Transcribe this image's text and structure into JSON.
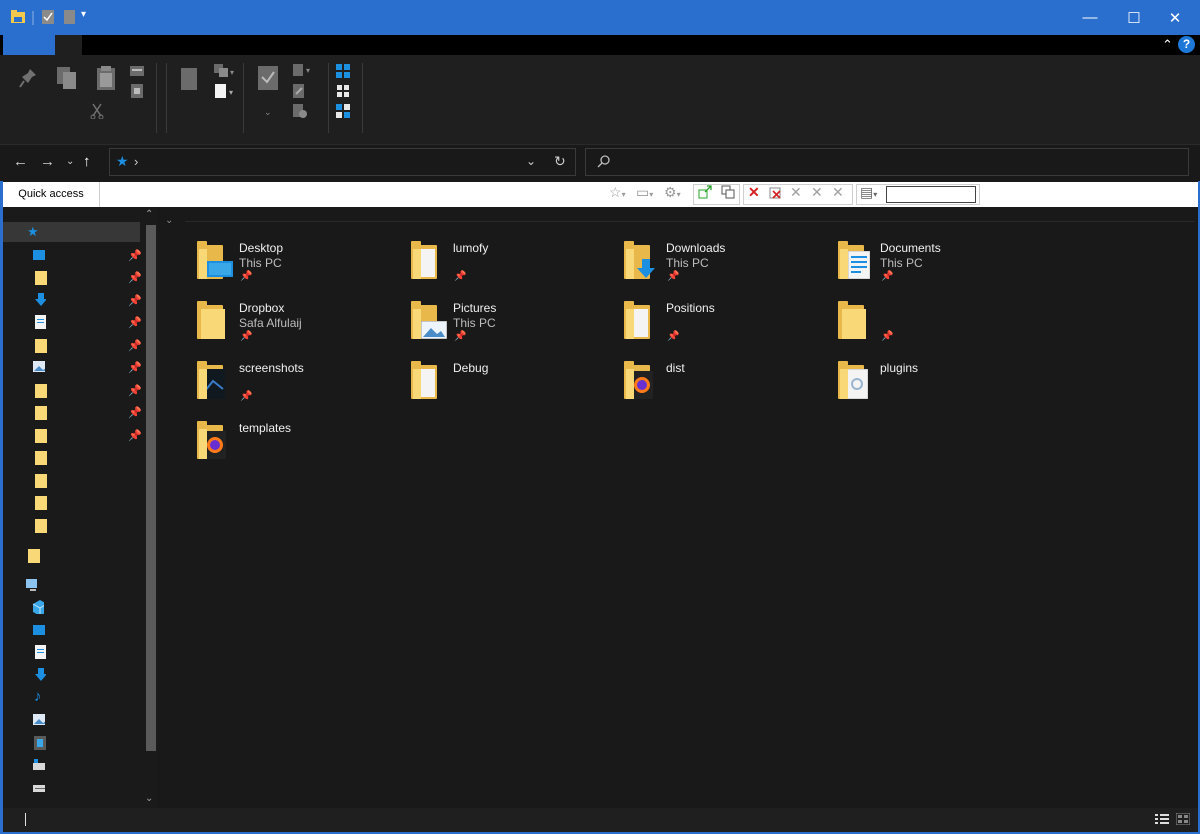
{
  "window": {
    "minimize_glyph": "—",
    "maximize_glyph": "☐",
    "close_glyph": "✕"
  },
  "ribbon": {
    "collapse_glyph": "⌃",
    "help_glyph": "?"
  },
  "address_bar": {
    "location_icon": "star-icon",
    "separator": "›",
    "value": ""
  },
  "search": {
    "placeholder": "",
    "icon": "search-icon"
  },
  "toolbar": {
    "breadcrumb_label": "Quick access",
    "filter_value": ""
  },
  "group_header": {
    "chevron": "⌄"
  },
  "colors": {
    "accent": "#2b6fce",
    "folder_back": "#e8b94a",
    "folder_front": "#f9d877",
    "background": "#191919"
  },
  "files": [
    {
      "name": "Desktop",
      "location": "This PC",
      "pinned": true,
      "overlay": "desktop-icon"
    },
    {
      "name": "lumofy",
      "location": "",
      "pinned": true,
      "overlay": "document-icon"
    },
    {
      "name": "Downloads",
      "location": "This PC",
      "pinned": true,
      "overlay": "download-arrow-icon"
    },
    {
      "name": "Documents",
      "location": "This PC",
      "pinned": true,
      "overlay": "text-document-icon"
    },
    {
      "name": "Dropbox",
      "location": "Safa Alfulaij",
      "pinned": true,
      "overlay": "none"
    },
    {
      "name": "Pictures",
      "location": "This PC",
      "pinned": true,
      "overlay": "landscape-photo-icon"
    },
    {
      "name": "Positions",
      "location": "",
      "pinned": true,
      "overlay": "document-icon"
    },
    {
      "name": "",
      "location": "",
      "pinned": true,
      "overlay": "none"
    },
    {
      "name": "screenshots",
      "location": "",
      "pinned": true,
      "overlay": "screenshot-thumbnail-icon"
    },
    {
      "name": "Debug",
      "location": "",
      "pinned": false,
      "overlay": "document-icon"
    },
    {
      "name": "dist",
      "location": "",
      "pinned": false,
      "overlay": "firefox-logo-icon"
    },
    {
      "name": "plugins",
      "location": "",
      "pinned": false,
      "overlay": "settings-document-icon"
    },
    {
      "name": "templates",
      "location": "",
      "pinned": false,
      "overlay": "firefox-logo-icon"
    }
  ]
}
